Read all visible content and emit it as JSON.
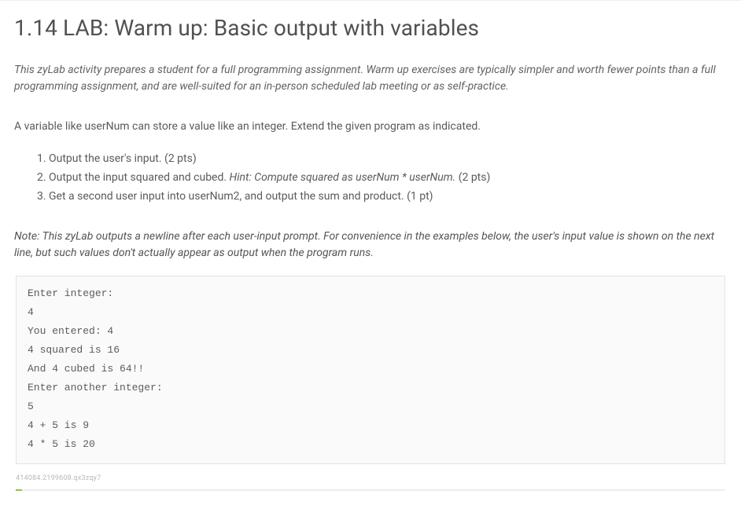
{
  "title": "1.14 LAB: Warm up: Basic output with variables",
  "intro": "This zyLab activity prepares a student for a full programming assignment. Warm up exercises are typically simpler and worth fewer points than a full programming assignment, and are well-suited for an in-person scheduled lab meeting or as self-practice.",
  "lead": "A variable like userNum can store a value like an integer. Extend the given program as indicated.",
  "steps": [
    {
      "text": "Output the user's input. (2 pts)",
      "hint": ""
    },
    {
      "text_pre": "Output the input squared and cubed. ",
      "hint": "Hint: Compute squared as userNum * userNum.",
      "text_post": " (2 pts)"
    },
    {
      "text": "Get a second user input into userNum2, and output the sum and product. (1 pt)",
      "hint": ""
    }
  ],
  "note_label": "Note:",
  "note_body": " This zyLab outputs a newline after each user-input prompt. For convenience in the examples below, the user's input value is shown on the next line, but such values don't actually appear as output when the program runs.",
  "output": "Enter integer:\n4\nYou entered: 4\n4 squared is 16\nAnd 4 cubed is 64!!\nEnter another integer:\n5\n4 + 5 is 9\n4 * 5 is 20",
  "footer_id": "414084.2199608.qx3zqy7"
}
